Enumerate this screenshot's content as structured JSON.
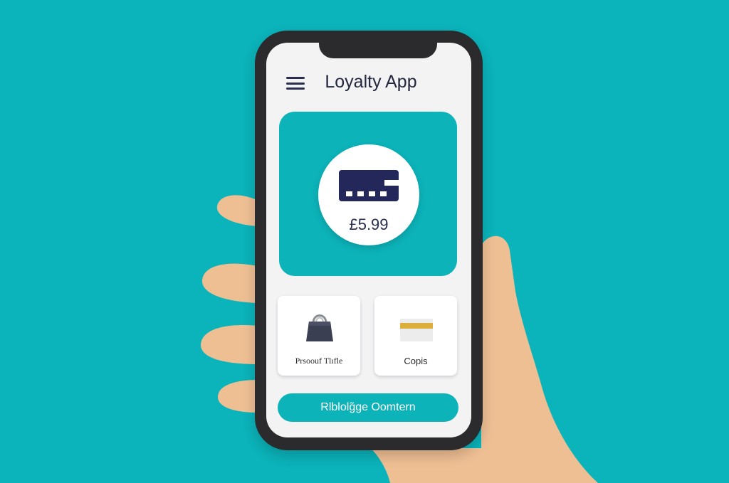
{
  "app": {
    "title": "Loyalty App"
  },
  "hero": {
    "balance": "£5.99"
  },
  "tiles": [
    {
      "label": "Prsoouf Tlıfle",
      "icon": "shopping-bag-icon"
    },
    {
      "label": "Copis",
      "icon": "coupon-icon"
    }
  ],
  "cta": {
    "label": "Rlblolg̃ɡe Oomtern"
  },
  "colors": {
    "background": "#0bb3ba",
    "accent": "#0cb3b9",
    "navy": "#2a2e4f",
    "skin": "#efbf94",
    "coupon_stripe": "#dcae3c"
  }
}
